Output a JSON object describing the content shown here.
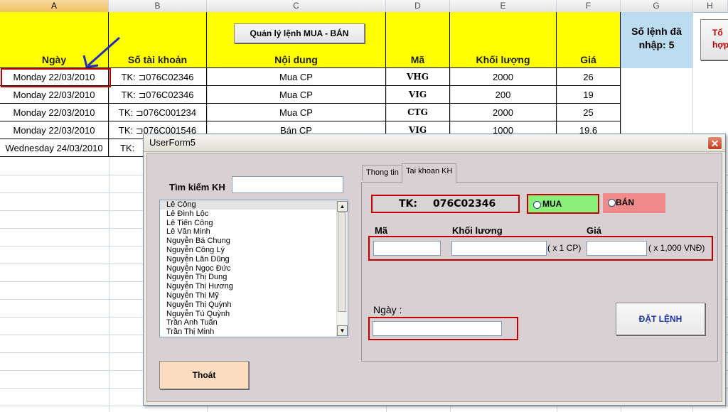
{
  "spreadsheet": {
    "columns": [
      "A",
      "B",
      "C",
      "D",
      "E",
      "F",
      "G",
      "H"
    ],
    "headers": {
      "date": "Ngày",
      "account": "Số tài khoản",
      "content": "Nội dung",
      "code": "Mã",
      "volume": "Khối lượng",
      "price": "Giá"
    },
    "top_button": "Quản lý lệnh MUA - BÁN",
    "count_label_line1": "Số lệnh đã",
    "count_label_line2": "nhập: 5",
    "partial_button_line1": "Tổ",
    "partial_button_line2": "hợp",
    "rows": [
      {
        "date": "Monday 22/03/2010",
        "account": "TK: ⊐076C02346",
        "content": "Mua CP",
        "code": "VHG",
        "volume": "2000",
        "price": "26"
      },
      {
        "date": "Monday 22/03/2010",
        "account": "TK: ⊐076C02346",
        "content": "Mua CP",
        "code": "VIG",
        "volume": "200",
        "price": "19"
      },
      {
        "date": "Monday 22/03/2010",
        "account": "TK: ⊐076C001234",
        "content": "Mua CP",
        "code": "CTG",
        "volume": "2000",
        "price": "25"
      },
      {
        "date": "Monday 22/03/2010",
        "account": "TK: ⊐076C001546",
        "content": "Bán CP",
        "code": "VIG",
        "volume": "1000",
        "price": "19.6"
      },
      {
        "date": "Wednesday 24/03/2010",
        "account": "TK: ",
        "content": "",
        "code": "",
        "volume": "",
        "price": ""
      }
    ]
  },
  "userform": {
    "title": "UserForm5",
    "close_glyph": "✕",
    "search_label": "Tìm kiếm KH",
    "search_value": "",
    "customers": [
      "Lê Công",
      "Lê Đình Lộc",
      "Lê Tiến Công",
      "Lê Văn Minh",
      "Nguyễn Bá Chung",
      "Nguyễn Công Lý",
      "Nguyễn Lân Dũng",
      "Nguyễn Ngọc Đức",
      "Nguyễn Thị Dung",
      "Nguyễn Thị Hương",
      "Nguyễn Thị Mỹ",
      "Nguyễn Thị Quỳnh",
      "Nguyễn Tú Quỳnh",
      "Trần Anh Tuấn",
      "Trần Thị Minh"
    ],
    "exit_button": "Thoát",
    "tabs": [
      "Thong tin",
      "Tai khoan KH"
    ],
    "tk_label": "TK:",
    "tk_value": "076C02346",
    "radio_buy": "MUA",
    "radio_sell": "BÁN",
    "code_label": "Mã",
    "volume_label": "Khối lương",
    "price_label": "Giá",
    "volume_unit": "( x 1 CP)",
    "price_unit": "( x 1,000 VNĐ)",
    "date_label": "Ngày :",
    "order_button": "ĐẶT LỆNH",
    "scroll_up": "▲",
    "scroll_down": "▼"
  },
  "colors": {
    "header_yellow": "#ffff00",
    "count_cell_blue": "#bcdcf0",
    "highlight_red": "#c00000",
    "buy_green": "#8af07a",
    "sell_pink": "#f08a8a",
    "exit_peach": "#fbdcc0",
    "order_blue_text": "#1a33a8",
    "annotation_arrow": "#1f2fb8"
  }
}
